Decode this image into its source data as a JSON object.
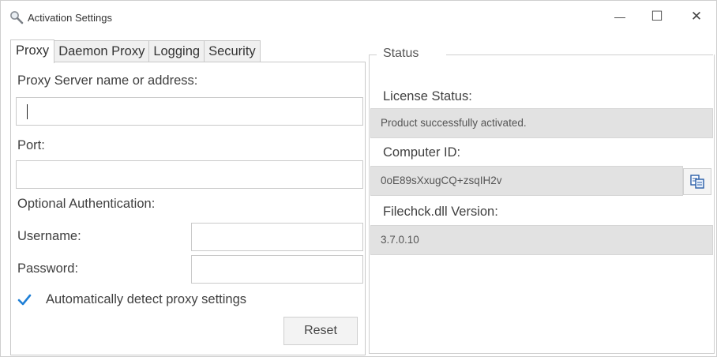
{
  "window": {
    "title": "Activation Settings",
    "minimize_glyph": "—",
    "maximize_glyph": "☐",
    "close_glyph": "✕"
  },
  "tabs": [
    {
      "label": "Proxy",
      "active": true
    },
    {
      "label": "Daemon Proxy",
      "active": false
    },
    {
      "label": "Logging",
      "active": false
    },
    {
      "label": "Security",
      "active": false
    }
  ],
  "proxy": {
    "server_label": "Proxy Server name or address:",
    "server_value": "",
    "port_label": "Port:",
    "port_value": "",
    "auth_label": "Optional Authentication:",
    "username_label": "Username:",
    "username_value": "",
    "password_label": "Password:",
    "password_value": "",
    "autodetect_label": "Automatically detect proxy settings",
    "autodetect_checked": true,
    "reset_label": "Reset"
  },
  "status": {
    "group_title": "Status",
    "license_label": "License Status:",
    "license_value": "Product successfully activated.",
    "computer_id_label": "Computer ID:",
    "computer_id_value": "0oE89sXxugCQ+zsqIH2v",
    "dll_label": "Filechck.dll Version:",
    "dll_value": "3.7.0.10"
  },
  "icons": {
    "app": "magnifier-icon",
    "check": "checkmark-icon",
    "copy": "copy-icon"
  },
  "colors": {
    "accent": "#1e7fd6",
    "readonly_bg": "#e2e2e2"
  }
}
